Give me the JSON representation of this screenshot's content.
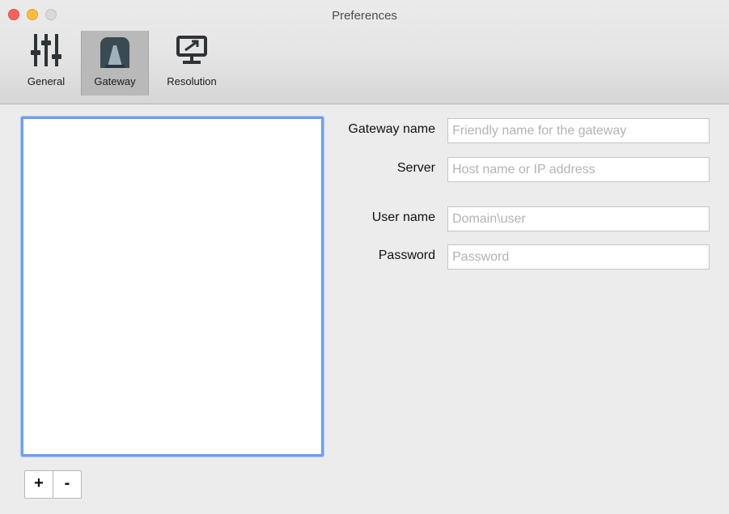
{
  "window": {
    "title": "Preferences"
  },
  "toolbar": {
    "items": [
      {
        "label": "General",
        "icon": "sliders-icon",
        "selected": false
      },
      {
        "label": "Gateway",
        "icon": "gateway-tunnel-icon",
        "selected": true
      },
      {
        "label": "Resolution",
        "icon": "display-resolution-icon",
        "selected": false
      }
    ]
  },
  "gateway_list": {
    "items": [],
    "add_label": "+",
    "remove_label": "-"
  },
  "form": {
    "gateway_name": {
      "label": "Gateway name",
      "value": "",
      "placeholder": "Friendly name for the gateway"
    },
    "server": {
      "label": "Server",
      "value": "",
      "placeholder": "Host name or IP address"
    },
    "user_name": {
      "label": "User name",
      "value": "",
      "placeholder": "Domain\\user"
    },
    "password": {
      "label": "Password",
      "value": "",
      "placeholder": "Password"
    }
  },
  "colors": {
    "focus_ring": "#6b9ff0",
    "selected_tool_bg": "#b9b9b9",
    "close": "#fc605c",
    "minimize": "#fdbc40",
    "zoom_disabled": "#d9d9d9"
  }
}
